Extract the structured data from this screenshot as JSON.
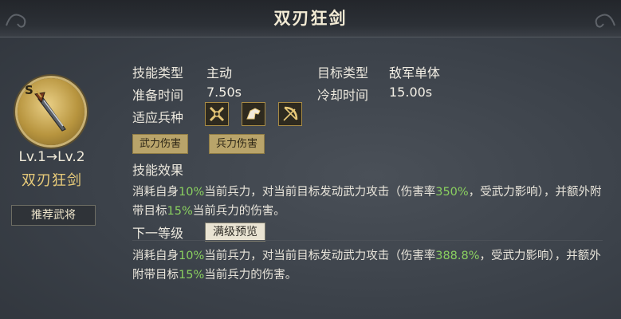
{
  "header": {
    "title": "双刃狂剑"
  },
  "skill": {
    "icon_tag": "S",
    "icon_name": "twin-blade-sword-icon",
    "level_from": "Lv.1",
    "level_arrow": "→",
    "level_to": "Lv.2",
    "name": "双刃狂剑",
    "recommend_label": "推荐武将"
  },
  "info": {
    "skill_type_label": "技能类型",
    "skill_type_value": "主动",
    "target_type_label": "目标类型",
    "target_type_value": "敌军单体",
    "prep_time_label": "准备时间",
    "prep_time_value": "7.50s",
    "cooldown_label": "冷却时间",
    "cooldown_value": "15.00s",
    "troops_label": "适应兵种",
    "troop_icons": [
      "crossed-swords-icon",
      "cavalry-icon",
      "archer-bow-icon"
    ]
  },
  "damage_tags": [
    "武力伤害",
    "兵力伤害"
  ],
  "effect": {
    "label": "技能效果",
    "part1": "消耗自身",
    "cost": "10%",
    "part2": "当前兵力，对当前目标发动武力攻击（伤害率",
    "rate": "350%",
    "part3": "，受武力影响），并额外附带目标",
    "extra": "15%",
    "part4": "当前兵力的伤害。"
  },
  "next": {
    "label": "下一等级",
    "max_preview_label": "满级预览",
    "part1": "消耗自身",
    "cost": "10%",
    "part2": "当前兵力，对当前目标发动武力攻击（伤害率",
    "rate": "388.8%",
    "part3": "，受武力影响），并额外附带目标",
    "extra": "15%",
    "part4": "当前兵力的伤害。"
  },
  "colors": {
    "highlight": "#8ad060",
    "gold": "#e9cc7a"
  }
}
